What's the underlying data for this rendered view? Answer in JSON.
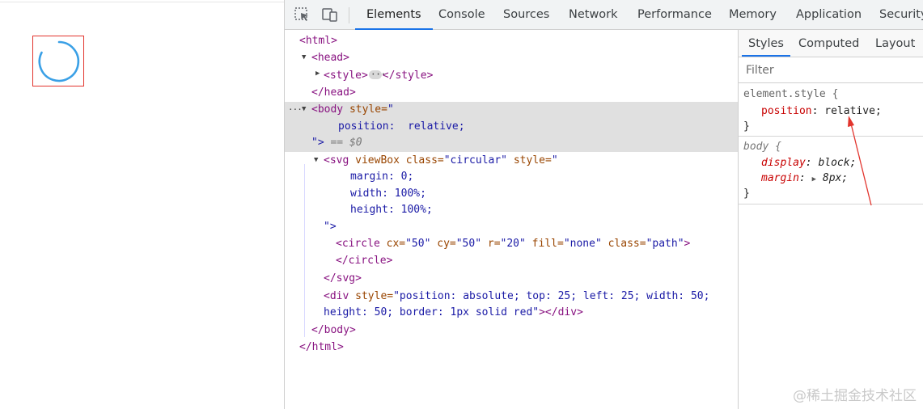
{
  "toolbar": {
    "tabs": [
      "Elements",
      "Console",
      "Sources",
      "Network",
      "Performance",
      "Memory",
      "Application",
      "Security"
    ],
    "active_tab": "Elements"
  },
  "elements": {
    "l01": "<html>",
    "l02": "<head>",
    "l03a": "<style>",
    "l03b": "</style>",
    "l04": "</head>",
    "l05_tag": "<body",
    "l05_attr": "style=",
    "l05_q": "\"",
    "l06": "position:  relative;",
    "l07_q": "\">",
    "l07_eq": " == $0",
    "l08_tag": "<svg",
    "l08_attr1": "viewBox",
    "l08_attr2": "class=",
    "l08_val2": "\"circular\"",
    "l08_attr3": "style=",
    "l08_q": "\"",
    "l09": "margin: 0;",
    "l10": "width: 100%;",
    "l11": "height: 100%;",
    "l12": "\">",
    "l13_tag": "<circle",
    "l13_a1": "cx=",
    "l13_v1": "\"50\"",
    "l13_a2": "cy=",
    "l13_v2": "\"50\"",
    "l13_a3": "r=",
    "l13_v3": "\"20\"",
    "l13_a4": "fill=",
    "l13_v4": "\"none\"",
    "l13_a5": "class=",
    "l13_v5": "\"path\"",
    "l13_end": ">",
    "l14": "</circle>",
    "l15": "</svg>",
    "l16_tag": "<div",
    "l16_attr": "style=",
    "l16_val": "\"position: absolute; top: 25; left: 25; width: 50;",
    "l17_val": "height: 50; border: 1px solid red\"",
    "l17_tag": "></div>",
    "l18": "</body>",
    "l19": "</html>"
  },
  "styles": {
    "subtabs": [
      "Styles",
      "Computed",
      "Layout"
    ],
    "active_subtab": "Styles",
    "filter_placeholder": "Filter",
    "rule1_selector": "element.style {",
    "rule1_prop": "position",
    "rule1_value": ": relative;",
    "rule1_close": "}",
    "rule2_selector": "body {",
    "rule2_p1": "display",
    "rule2_v1": ": block;",
    "rule2_p2": "margin",
    "rule2_v2": ": ",
    "rule2_v2b": " 8px;",
    "rule2_close": "}"
  },
  "preview": {
    "spinner_color": "#3aa0e6",
    "box_border_color": "#e2342d"
  },
  "watermark": "@稀土掘金技术社区"
}
